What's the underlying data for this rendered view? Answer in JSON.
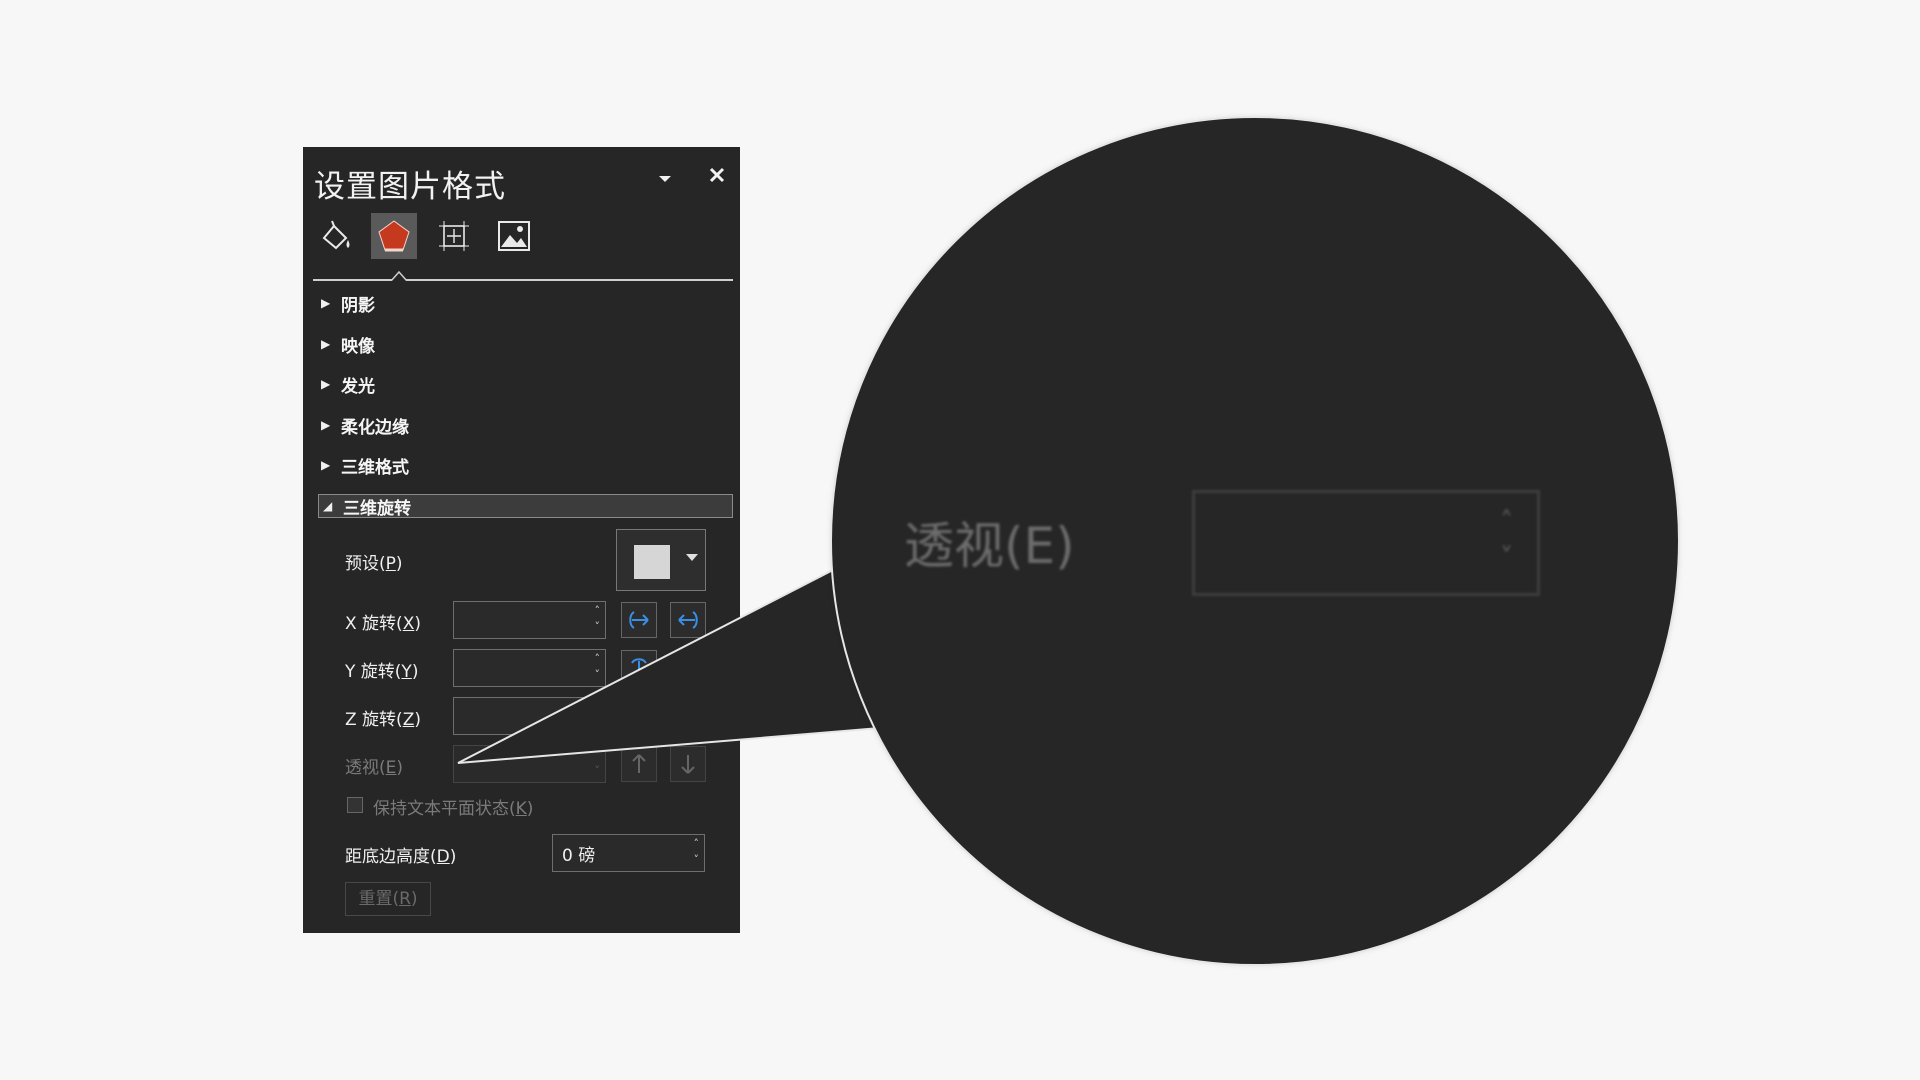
{
  "panel": {
    "title": "设置图片格式",
    "tabs": [
      {
        "icon": "fill-line-icon",
        "active": false
      },
      {
        "icon": "effects-pentagon-icon",
        "active": true
      },
      {
        "icon": "size-properties-icon",
        "active": false
      },
      {
        "icon": "picture-icon",
        "active": false
      }
    ],
    "sections": [
      {
        "label": "阴影",
        "expanded": false
      },
      {
        "label": "映像",
        "expanded": false
      },
      {
        "label": "发光",
        "expanded": false
      },
      {
        "label": "柔化边缘",
        "expanded": false
      },
      {
        "label": "三维格式",
        "expanded": false
      },
      {
        "label": "三维旋转",
        "expanded": true
      }
    ],
    "rotation": {
      "preset": {
        "label": "预设(",
        "key": "P",
        "tail": ")"
      },
      "x": {
        "label": "X 旋转(",
        "key": "X",
        "tail": ")",
        "value": ""
      },
      "y": {
        "label": "Y 旋转(",
        "key": "Y",
        "tail": ")",
        "value": ""
      },
      "z": {
        "label": "Z 旋转(",
        "key": "Z",
        "tail": ")",
        "value": ""
      },
      "perspective": {
        "label": "透视(",
        "key": "E",
        "tail": ")",
        "value": ""
      },
      "keep_flat": {
        "label": "保持文本平面状态(",
        "key": "K",
        "tail": ")",
        "checked": false
      },
      "distance": {
        "label": "距底边高度(",
        "key": "D",
        "tail": ")",
        "value": "0 磅"
      },
      "reset": {
        "label": "重置(",
        "key": "R",
        "tail": ")"
      }
    }
  },
  "zoom": {
    "label": "透视(E)",
    "value": ""
  },
  "colors": {
    "panel_bg": "#262626",
    "accent_red": "#c5391e",
    "icon_blue": "#3a8ee6"
  }
}
